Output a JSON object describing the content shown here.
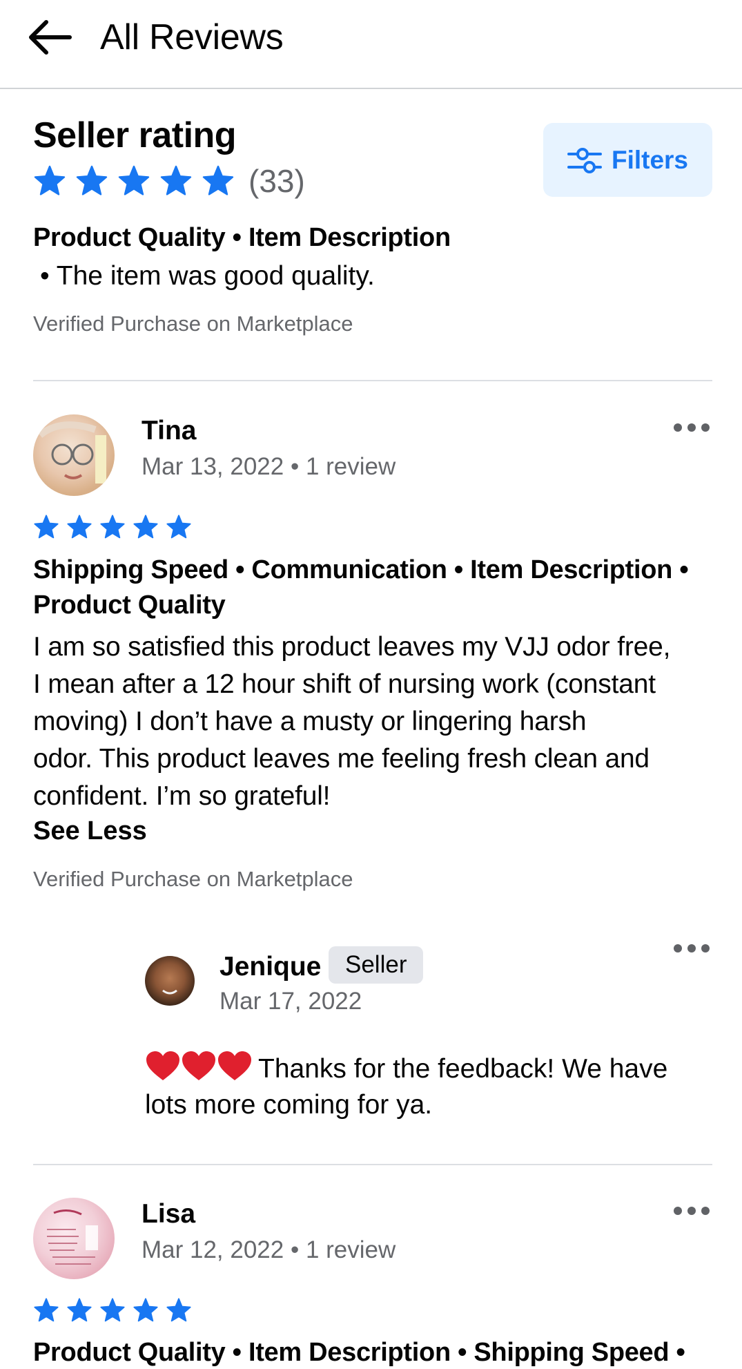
{
  "header": {
    "title": "All Reviews"
  },
  "summary": {
    "title": "Seller rating",
    "stars": 5,
    "count_text": "(33)",
    "filters_label": "Filters",
    "tags": "Product Quality • Item Description",
    "bullet_text": "• The item was good quality.",
    "verified": "Verified Purchase on Marketplace"
  },
  "reviews": [
    {
      "name": "Tina",
      "meta": "Mar 13, 2022 • 1 review",
      "stars": 5,
      "tags_line1": "Shipping Speed • Communication • Item Description •",
      "tags_line2": "Product Quality",
      "body_lines": [
        "I am so satisfied this product leaves my VJJ odor free,",
        "I mean after a 12 hour shift of nursing work (constant",
        "moving) I don’t have a musty or lingering harsh",
        "odor. This product leaves me feeling fresh clean and",
        "confident. I’m so grateful!"
      ],
      "see_less": "See Less",
      "verified": "Verified Purchase on Marketplace",
      "reply": {
        "name": "Jenique",
        "badge": "Seller",
        "date": "Mar 17, 2022",
        "line1": "Thanks for the feedback! We have",
        "line2": "lots more coming for ya."
      }
    },
    {
      "name": "Lisa",
      "meta": "Mar 12, 2022 • 1 review",
      "stars": 5,
      "tags_line1": "Product Quality • Item Description • Shipping Speed •"
    }
  ],
  "colors": {
    "accent": "#1877f2",
    "muted": "#65676b",
    "heart": "#e0202e",
    "filters_bg": "#e7f3ff"
  },
  "icons": [
    "back-arrow-icon",
    "star-icon",
    "filters-icon",
    "more-icon",
    "heart-icon"
  ]
}
